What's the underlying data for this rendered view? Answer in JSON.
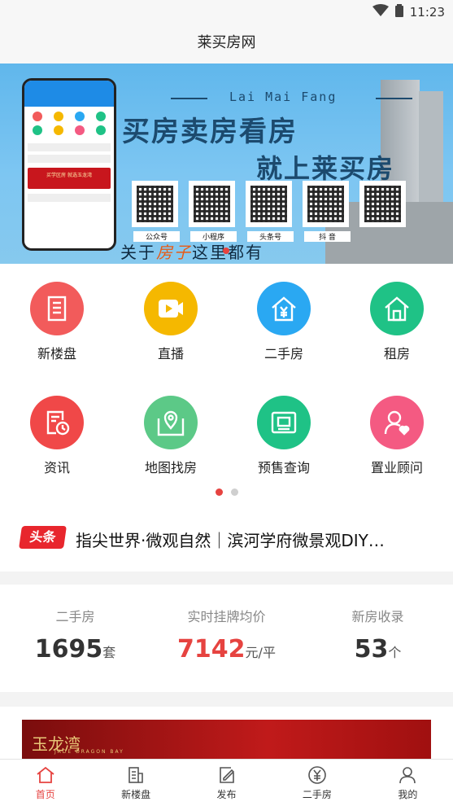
{
  "status": {
    "time": "11:23"
  },
  "app": {
    "title": "莱买房网"
  },
  "banner": {
    "latin": "Lai Mai Fang",
    "title1": "买房卖房看房",
    "title2": "就上莱买房",
    "qr_labels": [
      "公众号",
      "小程序",
      "头条号",
      "抖 音",
      ""
    ],
    "slogan_pre": "关于",
    "slogan_hl": "房子",
    "slogan_post": "这里都有",
    "phone_banner": "买学区房 就选玉龙湾"
  },
  "grid": [
    {
      "label": "新楼盘",
      "color": "#f25b5b",
      "icon": "building-icon"
    },
    {
      "label": "直播",
      "color": "#f5b800",
      "icon": "video-icon"
    },
    {
      "label": "二手房",
      "color": "#2aa8f2",
      "icon": "yen-house-icon"
    },
    {
      "label": "租房",
      "color": "#1fc286",
      "icon": "house-icon"
    },
    {
      "label": "资讯",
      "color": "#f04848",
      "icon": "news-clock-icon"
    },
    {
      "label": "地图找房",
      "color": "#5cc987",
      "icon": "map-pin-icon"
    },
    {
      "label": "预售查询",
      "color": "#1fc286",
      "icon": "certificate-icon"
    },
    {
      "label": "置业顾问",
      "color": "#f45a82",
      "icon": "advisor-icon"
    }
  ],
  "news": {
    "tag": "头条",
    "text": "指尖世界·微观自然｜滨河学府微景观DIY…"
  },
  "stats": [
    {
      "label": "二手房",
      "value": "1695",
      "unit": "套"
    },
    {
      "label": "实时挂牌均价",
      "value": "7142",
      "unit": "元/平"
    },
    {
      "label": "新房收录",
      "value": "53",
      "unit": "个"
    }
  ],
  "ad": {
    "logo": "玉龙湾",
    "sub": "JADE DRAGON BAY"
  },
  "tabs": [
    {
      "label": "首页",
      "icon": "home-icon"
    },
    {
      "label": "新楼盘",
      "icon": "building-icon"
    },
    {
      "label": "发布",
      "icon": "edit-icon"
    },
    {
      "label": "二手房",
      "icon": "yen-icon"
    },
    {
      "label": "我的",
      "icon": "user-icon"
    }
  ],
  "colors": {
    "accent": "#e64340",
    "brand_blue": "#1c4a6e"
  }
}
